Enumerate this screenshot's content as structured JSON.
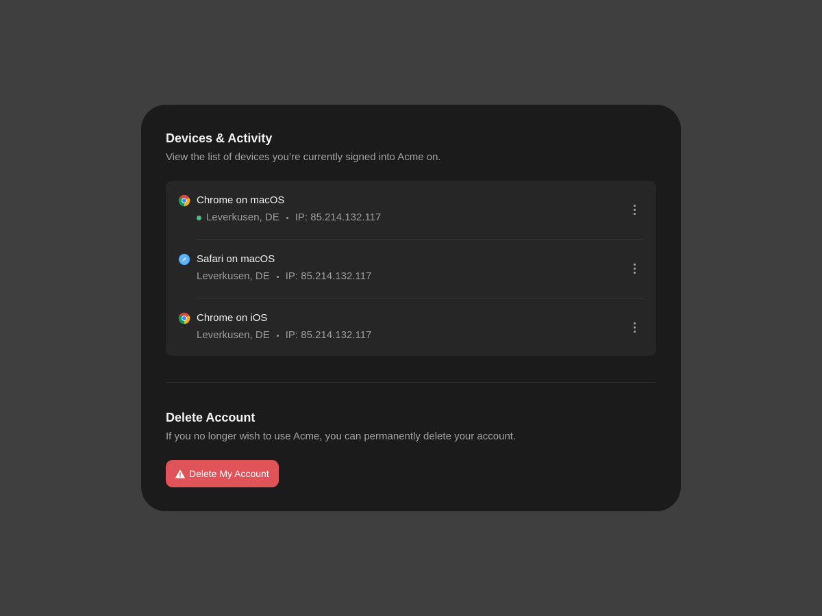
{
  "devices_section": {
    "title": "Devices & Activity",
    "description": "View the list of devices you’re currently signed into Acme on."
  },
  "devices": [
    {
      "icon": "chrome-icon",
      "name": "Chrome on macOS",
      "active": true,
      "location": "Leverkusen, DE",
      "ip": "IP: 85.214.132.117"
    },
    {
      "icon": "safari-icon",
      "name": "Safari on macOS",
      "active": false,
      "location": "Leverkusen, DE",
      "ip": "IP: 85.214.132.117"
    },
    {
      "icon": "chrome-icon",
      "name": "Chrome on iOS",
      "active": false,
      "location": "Leverkusen, DE",
      "ip": "IP: 85.214.132.117"
    }
  ],
  "delete_section": {
    "title": "Delete Account",
    "description": "If you no longer wish to use Acme, you can permanently delete your account.",
    "button_label": "Delete My Account",
    "button_icon": "warning-icon"
  },
  "colors": {
    "page_background": "#3f3f3f",
    "card_background": "#1b1b1b",
    "list_background": "#262626",
    "active_status": "#4cc07a",
    "danger": "#e05358"
  }
}
